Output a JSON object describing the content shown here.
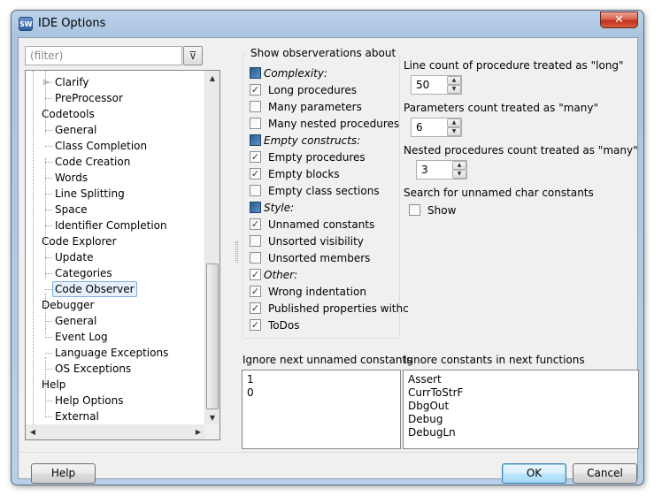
{
  "window": {
    "title": "IDE Options",
    "close_label": "✕",
    "app_icon_text": "SW"
  },
  "filter": {
    "placeholder": "(filter)"
  },
  "tree": {
    "items": [
      {
        "label": "Clarify",
        "level": 1,
        "has_expander": true
      },
      {
        "label": "PreProcessor",
        "level": 1
      },
      {
        "label": "Codetools",
        "level": 0
      },
      {
        "label": "General",
        "level": 1
      },
      {
        "label": "Class Completion",
        "level": 1
      },
      {
        "label": "Code Creation",
        "level": 1
      },
      {
        "label": "Words",
        "level": 1
      },
      {
        "label": "Line Splitting",
        "level": 1
      },
      {
        "label": "Space",
        "level": 1
      },
      {
        "label": "Identifier Completion",
        "level": 1
      },
      {
        "label": "Code Explorer",
        "level": 0
      },
      {
        "label": "Update",
        "level": 1
      },
      {
        "label": "Categories",
        "level": 1
      },
      {
        "label": "Code Observer",
        "level": 1,
        "selected": true
      },
      {
        "label": "Debugger",
        "level": 0
      },
      {
        "label": "General",
        "level": 1
      },
      {
        "label": "Event Log",
        "level": 1
      },
      {
        "label": "Language Exceptions",
        "level": 1
      },
      {
        "label": "OS Exceptions",
        "level": 1
      },
      {
        "label": "Help",
        "level": 0
      },
      {
        "label": "Help Options",
        "level": 1
      },
      {
        "label": "External",
        "level": 1
      }
    ]
  },
  "observations": {
    "title": "Show observerations about",
    "rows": [
      {
        "label": "Complexity:",
        "category": true,
        "checked": "partial"
      },
      {
        "label": "Long procedures",
        "checked": true
      },
      {
        "label": "Many parameters",
        "checked": false
      },
      {
        "label": "Many nested procedures",
        "checked": false
      },
      {
        "label": "Empty constructs:",
        "category": true,
        "checked": "partial"
      },
      {
        "label": "Empty procedures",
        "checked": true
      },
      {
        "label": "Empty blocks",
        "checked": true
      },
      {
        "label": "Empty class sections",
        "checked": false
      },
      {
        "label": "Style:",
        "category": true,
        "checked": "partial"
      },
      {
        "label": "Unnamed constants",
        "checked": true
      },
      {
        "label": "Unsorted visibility",
        "checked": false
      },
      {
        "label": "Unsorted members",
        "checked": false
      },
      {
        "label": "Other:",
        "category": true,
        "checked": true
      },
      {
        "label": "Wrong indentation",
        "checked": true
      },
      {
        "label": "Published properties withc",
        "checked": true
      },
      {
        "label": "ToDos",
        "checked": true
      }
    ]
  },
  "settings": {
    "long_label": "Line count of procedure treated as \"long\"",
    "long_value": "50",
    "params_label": "Parameters count treated as \"many\"",
    "params_value": "6",
    "nested_label": "Nested procedures count treated as \"many\"",
    "nested_value": "3",
    "search_label": "Search for unnamed char constants",
    "show_label": "Show",
    "show_checked": false
  },
  "ignore_constants": {
    "label": "Ignore next unnamed constants",
    "values": [
      "1",
      "0"
    ]
  },
  "ignore_functions": {
    "label": "Ignore constants in next functions",
    "values": [
      "Assert",
      "CurrToStrF",
      "DbgOut",
      "Debug",
      "DebugLn"
    ]
  },
  "buttons": {
    "help": "Help",
    "ok": "OK",
    "cancel": "Cancel"
  }
}
